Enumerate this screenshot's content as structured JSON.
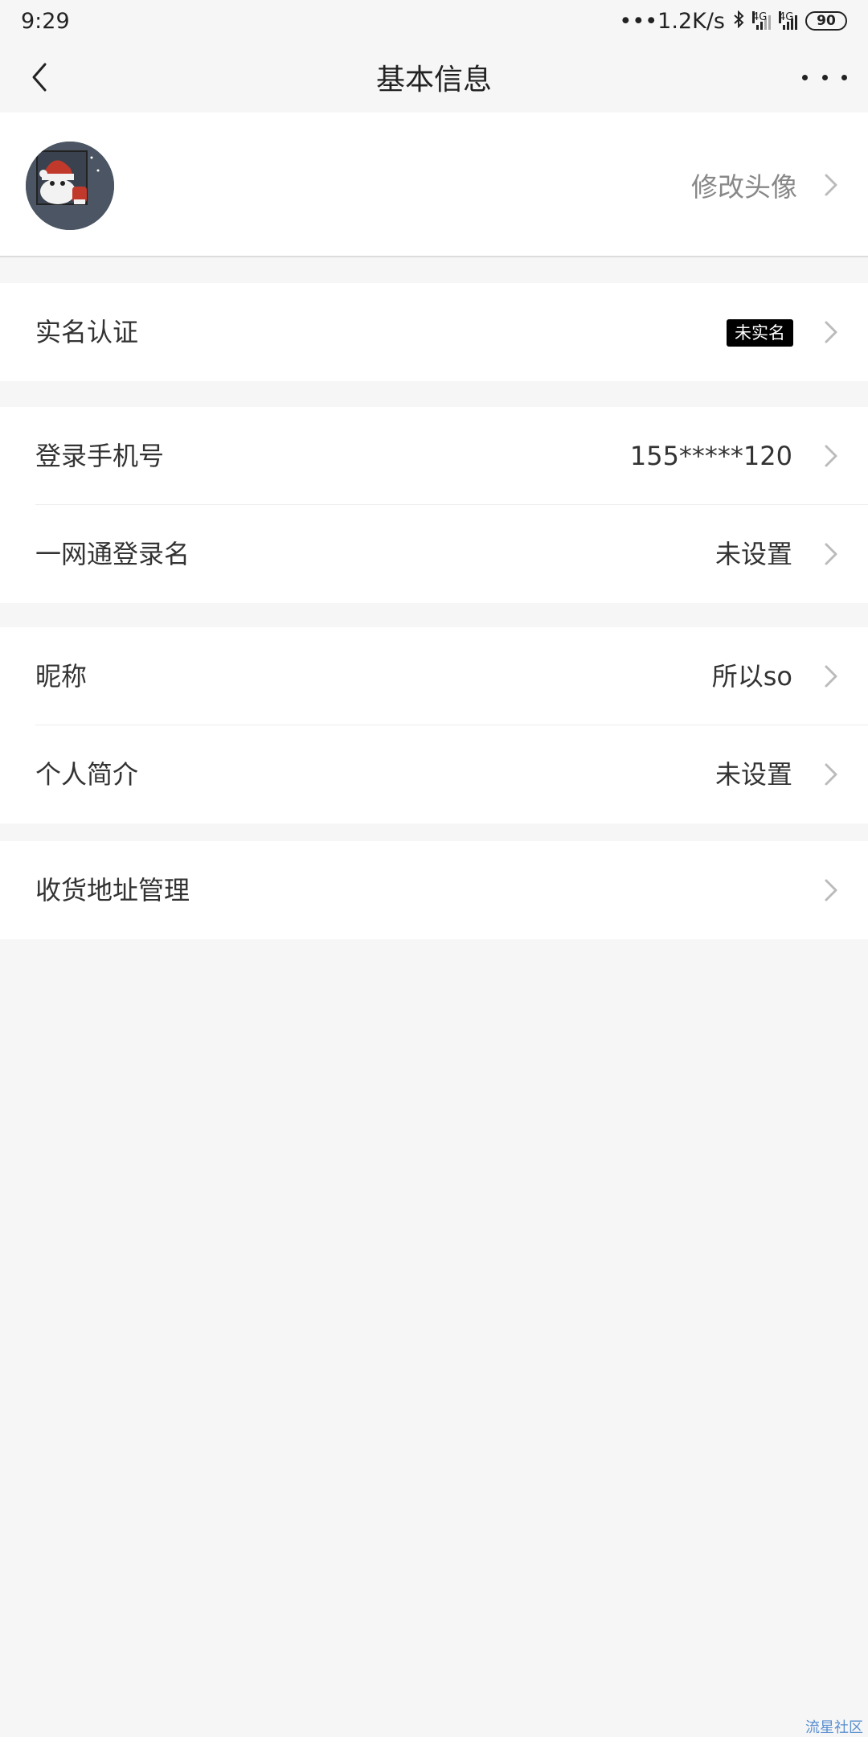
{
  "status_bar": {
    "time": "9:29",
    "network_speed": "•••1.2K/s",
    "sim1_label": "4G",
    "sim2_label": "4G",
    "battery": "90"
  },
  "header": {
    "title": "基本信息"
  },
  "avatar_row": {
    "action_label": "修改头像"
  },
  "sections": {
    "verification": {
      "label": "实名认证",
      "badge": "未实名"
    },
    "phone": {
      "label": "登录手机号",
      "value": "155*****120"
    },
    "login_name": {
      "label": "一网通登录名",
      "value": "未设置"
    },
    "nickname": {
      "label": "昵称",
      "value": "所以so"
    },
    "bio": {
      "label": "个人简介",
      "value": "未设置"
    },
    "address": {
      "label": "收货地址管理"
    }
  },
  "watermark": "流星社区",
  "colors": {
    "background": "#f6f6f6",
    "card": "#ffffff",
    "badge_bg": "#000000",
    "muted_text": "#888888",
    "chevron": "#bbbbbb"
  }
}
